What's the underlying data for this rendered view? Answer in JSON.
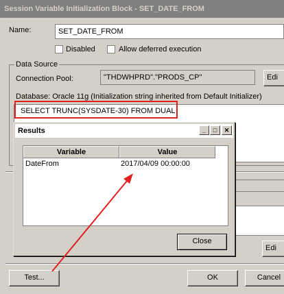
{
  "window": {
    "title": "Session Variable Initialization Block - SET_DATE_FROM"
  },
  "form": {
    "name_label": "Name:",
    "name_value": "SET_DATE_FROM",
    "disabled_label": "Disabled",
    "deferred_label": "Allow deferred execution",
    "data_source_label": "Data Source",
    "connection_pool_label": "Connection Pool:",
    "connection_pool_value": "\"THDWHPRD\".\"PRODS_CP\"",
    "edit_button_label": "Edi",
    "database_text": "Database: Oracle 11g (Initialization string inherited from Default Initializer)",
    "sql_text": "SELECT  TRUNC(SYSDATE-30)  FROM DUAL",
    "edit2_button_label": "Edi"
  },
  "buttons": {
    "test": "Test...",
    "ok": "OK",
    "cancel": "Cancel"
  },
  "results_dialog": {
    "title": "Results",
    "columns": [
      "Variable",
      "Value"
    ],
    "rows": [
      {
        "variable": "DateFrom",
        "value": "2017/04/09 00:00:00"
      }
    ],
    "close_label": "Close",
    "minimize_glyph": "_",
    "maximize_glyph": "□",
    "close_glyph": "✕"
  },
  "colors": {
    "annotation": "#e02020"
  }
}
